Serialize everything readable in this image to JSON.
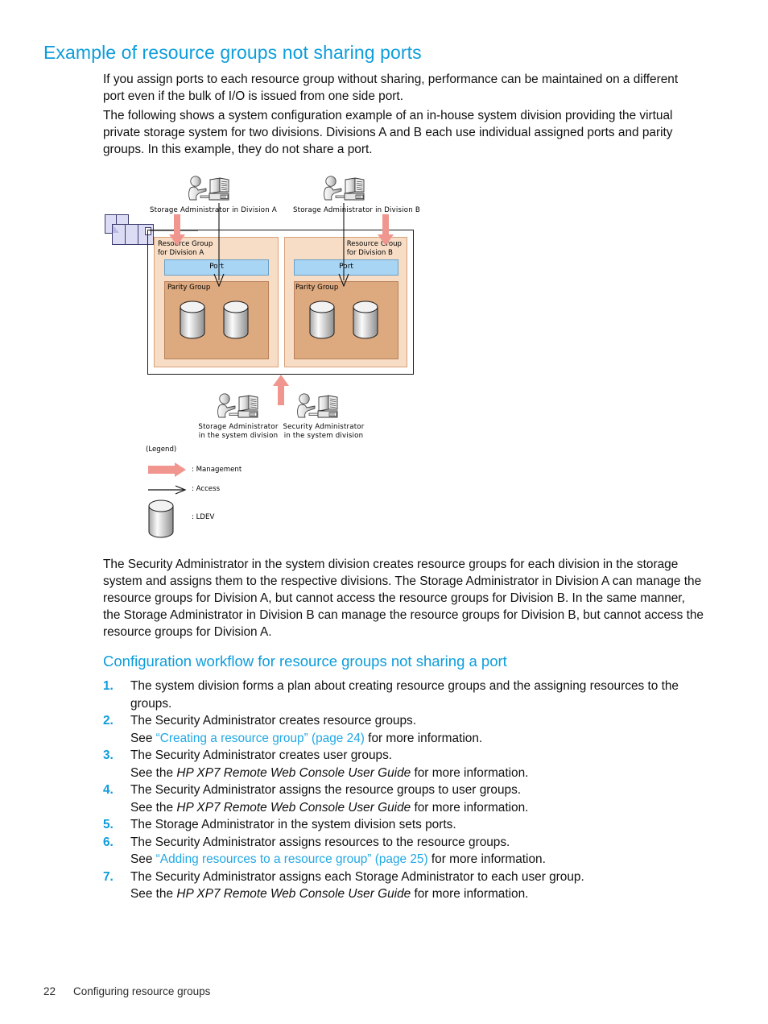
{
  "page": {
    "title": "Example of resource groups not sharing ports",
    "intro_paragraph_1": "If you assign ports to each resource group without sharing, performance can be maintained on a different port even if the bulk of I/O is issued from one side port.",
    "intro_paragraph_2": "The following shows a system configuration example of an in-house system division providing the virtual private storage system for two divisions. Divisions A and B each use individual assigned ports and parity groups. In this example, they do not share a port.",
    "explain_paragraph": "The Security Administrator in the system division creates resource groups for each division in the storage system and assigns them to the respective divisions. The Storage Administrator in Division A can manage the resource groups for Division A, but cannot access the resource groups for Division B. In the same manner, the Storage Administrator in Division B can manage the resource groups for Division B, but cannot access the resource groups for Division A.",
    "section_heading": "Configuration workflow for resource groups not sharing a port"
  },
  "workflow": [
    {
      "number": "1.",
      "text": "The system division forms a plan about creating resource groups and the assigning resources to the groups.",
      "note": null
    },
    {
      "number": "2.",
      "text": "The Security Administrator creates resource groups.",
      "note": {
        "prefix": "See ",
        "link": "“Creating a resource group” (page 24)",
        "suffix": " for more information.",
        "italic": null
      }
    },
    {
      "number": "3.",
      "text": "The Security Administrator creates user groups.",
      "note": {
        "prefix": "See the ",
        "link": null,
        "italic": "HP XP7 Remote Web Console User Guide",
        "suffix": " for more information."
      }
    },
    {
      "number": "4.",
      "text": "The Security Administrator assigns the resource groups to user groups.",
      "note": {
        "prefix": "See the ",
        "link": null,
        "italic": "HP XP7 Remote Web Console User Guide",
        "suffix": " for more information."
      }
    },
    {
      "number": "5.",
      "text": "The Storage Administrator in the system division sets ports.",
      "note": null
    },
    {
      "number": "6.",
      "text": "The Security Administrator assigns resources to the resource groups.",
      "note": {
        "prefix": "See ",
        "link": "“Adding resources to a resource group” (page 25)",
        "suffix": " for more information.",
        "italic": null
      }
    },
    {
      "number": "7.",
      "text": "The Security Administrator assigns each Storage Administrator to each user group.",
      "note": {
        "prefix": "See the ",
        "link": null,
        "italic": "HP XP7 Remote Web Console User Guide",
        "suffix": " for more information."
      }
    }
  ],
  "diagram": {
    "admin_top_a": "Storage Administrator in Division A",
    "admin_top_b": "Storage Administrator in Division B",
    "resource_group_a_line1": "Resource Group",
    "resource_group_a_line2": "for Division A",
    "resource_group_b_line1": "Resource Group",
    "resource_group_b_line2": "for Division B",
    "port_a": "Port",
    "port_b": "Port",
    "parity_group_a": "Parity Group",
    "parity_group_b": "Parity Group",
    "admin_bottom_1_line1": "Storage Administrator",
    "admin_bottom_1_line2": "in the system division",
    "admin_bottom_2_line1": "Security Administrator",
    "admin_bottom_2_line2": "in the system division",
    "legend_title": "(Legend)",
    "legend_management": ": Management",
    "legend_access": ": Access",
    "legend_ldev": ": LDEV"
  },
  "footer": {
    "page_number": "22",
    "chapter": "Configuring resource groups"
  },
  "colors": {
    "heading_blue": "#0d9ddb",
    "link_blue": "#21a8e4",
    "resource_group_fill": "#f7ddc6",
    "parity_group_fill": "#dda97f",
    "port_fill": "#a9d5f5",
    "management_arrow": "#f0968f",
    "rack_fill": "#dcdcf4"
  }
}
